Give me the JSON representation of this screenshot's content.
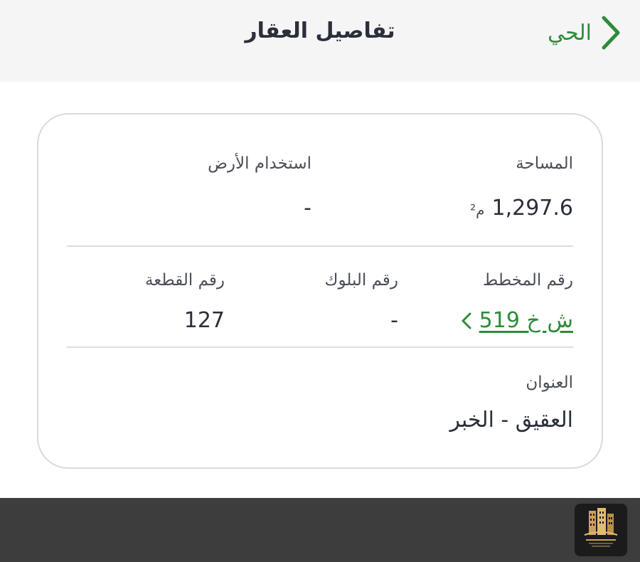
{
  "header": {
    "title": "تفاصيل العقار",
    "back_label": "الحي"
  },
  "details": {
    "area": {
      "label": "المساحة",
      "value": "1,297.6",
      "unit": "م²"
    },
    "land_use": {
      "label": "استخدام الأرض",
      "value": "-"
    },
    "plan_number": {
      "label": "رقم المخطط",
      "value": "ش خ 519"
    },
    "block_number": {
      "label": "رقم البلوك",
      "value": "-"
    },
    "plot_number": {
      "label": "رقم القطعة",
      "value": "127"
    },
    "address": {
      "label": "العنوان",
      "value": "العقيق - الخبر"
    }
  },
  "colors": {
    "accent": "#2e8b3a",
    "header_bg": "#f5f5f6",
    "footer_bg": "#3d3d3d"
  },
  "icons": {
    "back": "chevron-right-icon",
    "plan_link": "chevron-left-icon",
    "logo": "building-logo-icon"
  }
}
